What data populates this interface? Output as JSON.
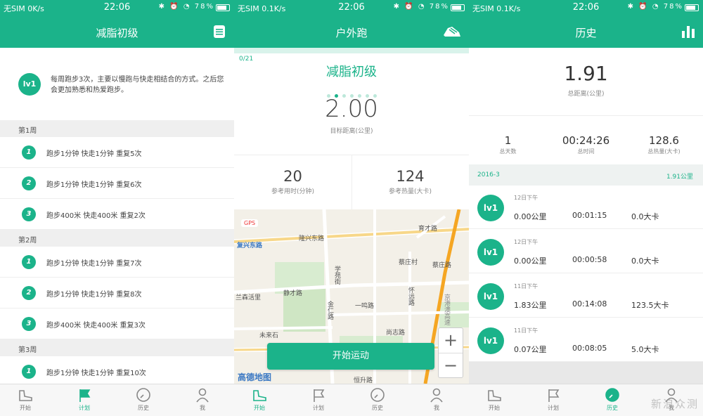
{
  "colors": {
    "accent": "#1bb38a"
  },
  "status": {
    "p1": {
      "carrier": "无SIM 0K/s",
      "time": "22:06",
      "battery": "78%"
    },
    "p2": {
      "carrier": "无SIM 0.1K/s",
      "time": "22:06",
      "battery": "78%"
    },
    "p3": {
      "carrier": "无SIM 0.1K/s",
      "time": "22:06",
      "battery": "78%"
    }
  },
  "plan": {
    "title": "减脂初级",
    "header_icon": "list-icon",
    "level_badge": "lv1",
    "description": "每周跑步3次，主要以慢跑与快走相结合的方式。之后您会更加熟悉和热爱跑步。",
    "weeks": [
      {
        "label": "第1周",
        "items": [
          {
            "num": "1",
            "text": "跑步1分钟  快走1分钟  重复5次"
          },
          {
            "num": "2",
            "text": "跑步1分钟  快走1分钟  重复6次"
          },
          {
            "num": "3",
            "text": "跑步400米  快走400米  重复2次"
          }
        ]
      },
      {
        "label": "第2周",
        "items": [
          {
            "num": "1",
            "text": "跑步1分钟  快走1分钟  重复7次"
          },
          {
            "num": "2",
            "text": "跑步1分钟  快走1分钟  重复8次"
          },
          {
            "num": "3",
            "text": "跑步400米  快走400米  重复3次"
          }
        ]
      },
      {
        "label": "第3周",
        "items": [
          {
            "num": "1",
            "text": "跑步1分钟  快走1分钟  重复10次"
          }
        ]
      }
    ]
  },
  "outdoor": {
    "title": "户外跑",
    "header_icon": "shoe-icon",
    "progress": "0/21",
    "plan_name": "减脂初级",
    "page_dots": 7,
    "active_dot": 1,
    "target_distance": "2.00",
    "target_distance_label": "目标距离(公里)",
    "ref_time": "20",
    "ref_time_label": "参考用时(分钟)",
    "ref_cal": "124",
    "ref_cal_label": "参考热量(大卡)",
    "start_label": "开始运动",
    "gps_label": "GPS",
    "zoom_in": "+",
    "zoom_out": "−",
    "map_brand": "高德地图",
    "map_labels": [
      "隆兴东路",
      "复兴东路",
      "育才路",
      "蔡庄村",
      "蔡庄路",
      "学苑街",
      "静才路",
      "兰森活里",
      "怀远路",
      "一鸣路",
      "金仁路",
      "京港澳高速",
      "尚志路",
      "未来石",
      "恒升路"
    ]
  },
  "history": {
    "title": "历史",
    "header_icon": "bar-chart-icon",
    "total_distance": "1.91",
    "total_distance_label": "总距离(公里)",
    "stats": [
      {
        "value": "1",
        "label": "总天数"
      },
      {
        "value": "00:24:26",
        "label": "总时间"
      },
      {
        "value": "128.6",
        "label": "总热量(大卡)"
      }
    ],
    "month": "2016-3",
    "month_distance": "1.91公里",
    "records": [
      {
        "when": "12日下午",
        "distance": "0.00公里",
        "duration": "00:01:15",
        "calories": "0.0大卡"
      },
      {
        "when": "12日下午",
        "distance": "0.00公里",
        "duration": "00:00:58",
        "calories": "0.0大卡"
      },
      {
        "when": "11日下午",
        "distance": "1.83公里",
        "duration": "00:14:08",
        "calories": "123.5大卡"
      },
      {
        "when": "11日下午",
        "distance": "0.07公里",
        "duration": "00:08:05",
        "calories": "5.0大卡"
      }
    ]
  },
  "tabs": [
    {
      "label": "开始",
      "icon": "shoe-icon"
    },
    {
      "label": "计划",
      "icon": "flag-icon"
    },
    {
      "label": "历史",
      "icon": "clock-icon"
    },
    {
      "label": "我",
      "icon": "person-icon"
    }
  ],
  "active_tab": {
    "p1": 1,
    "p2": 0,
    "p3": 2
  },
  "watermark": "新浪众测"
}
